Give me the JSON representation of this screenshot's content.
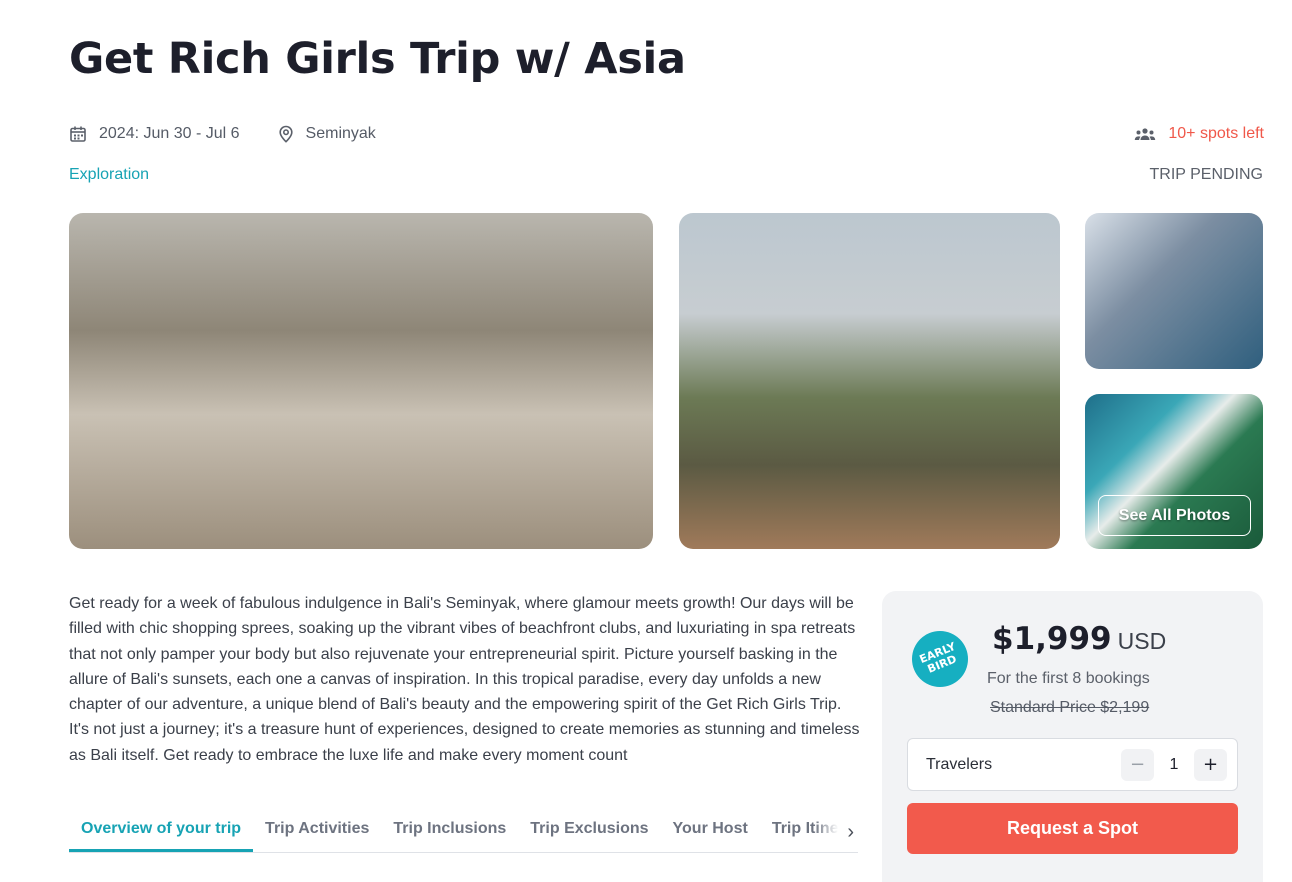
{
  "trip": {
    "title": "Get Rich Girls Trip w/ Asia",
    "dates": "2024: Jun 30 - Jul 6",
    "location": "Seminyak",
    "spots_left": "10+ spots left",
    "category": "Exploration",
    "status": "TRIP PENDING"
  },
  "gallery": {
    "see_all_label": "See All Photos"
  },
  "description": "Get ready for a week of fabulous indulgence in Bali's Seminyak, where glamour meets growth! Our days will be filled with chic shopping sprees, soaking up the vibrant vibes of beachfront clubs, and luxuriating in spa retreats that not only pamper your body but also rejuvenate your entrepreneurial spirit. Picture yourself basking in the allure of Bali's sunsets, each one a canvas of inspiration. In this tropical paradise, every day unfolds a new chapter of our adventure, a unique blend of Bali's beauty and the empowering spirit of the Get Rich Girls Trip. It's not just a journey; it's a treasure hunt of experiences, designed to create memories as stunning and timeless as Bali itself. Get ready to embrace the luxe life and make every moment count",
  "tabs": [
    {
      "label": "Overview of your trip",
      "active": true
    },
    {
      "label": "Trip Activities",
      "active": false
    },
    {
      "label": "Trip Inclusions",
      "active": false
    },
    {
      "label": "Trip Exclusions",
      "active": false
    },
    {
      "label": "Your Host",
      "active": false
    },
    {
      "label": "Trip Itinerary",
      "active": false
    }
  ],
  "booking": {
    "badge_line1": "EARLY",
    "badge_line2": "BIRD",
    "price": "$1,999",
    "currency": "USD",
    "price_note": "For the first 8 bookings",
    "standard_price": "Standard Price $2,199",
    "travelers_label": "Travelers",
    "travelers_count": "1",
    "minus_label": "−",
    "plus_label": "+",
    "request_label": "Request a Spot"
  },
  "icons": {
    "calendar": "calendar-icon",
    "location": "location-pin-icon",
    "people": "people-icon",
    "chevron": "chevron-right-icon"
  },
  "colors": {
    "accent_teal": "#17a3b4",
    "accent_red": "#f25a4c",
    "spots_red": "#f0584a"
  }
}
